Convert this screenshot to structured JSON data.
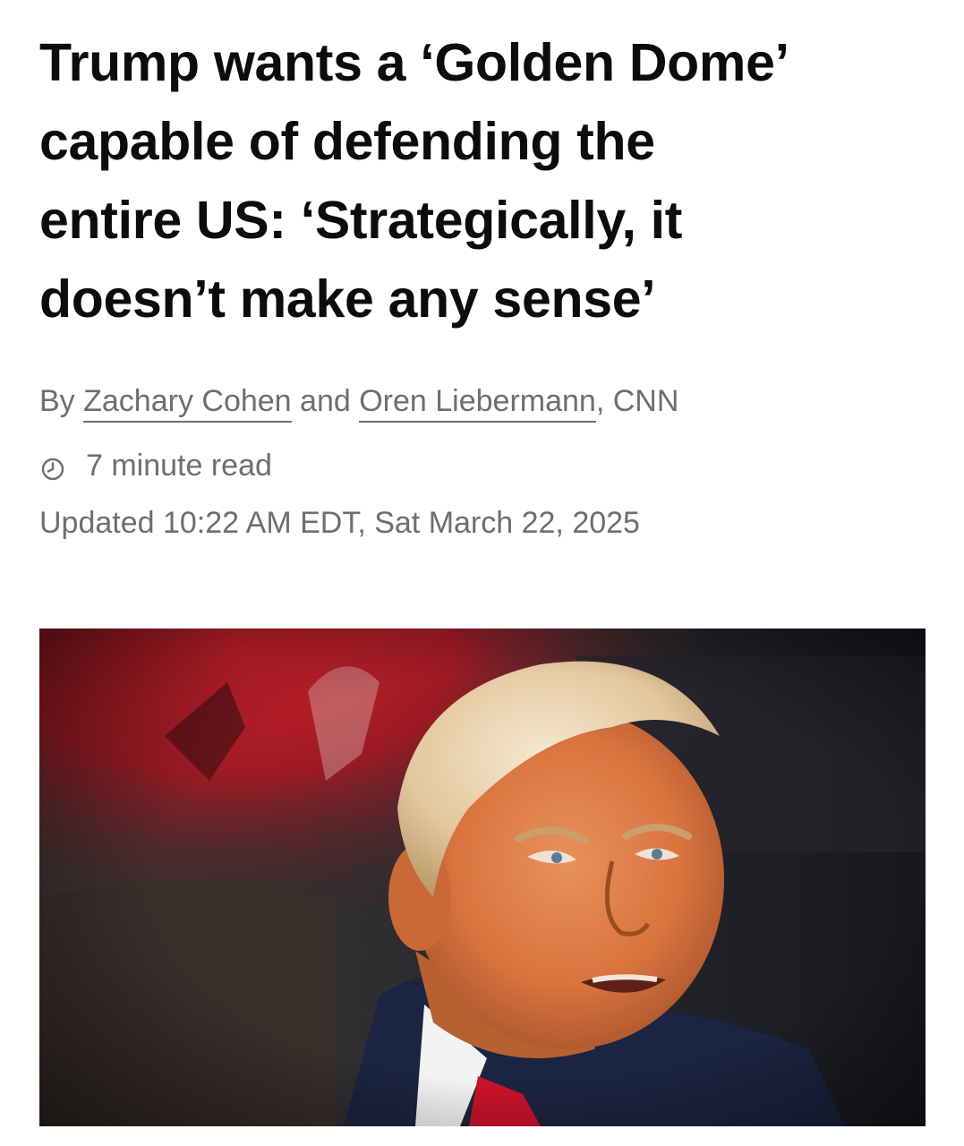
{
  "article": {
    "headline_lines": [
      "Trump wants a ‘Golden Dome’",
      "capable of defending the",
      "entire US: ‘Strategically, it",
      "doesn’t make any sense’"
    ],
    "byline": {
      "prefix": "By ",
      "authors": [
        "Zachary Cohen",
        "Oren Liebermann"
      ],
      "conjunction": " and ",
      "suffix": ", CNN"
    },
    "read_time": "7 minute read",
    "updated": "Updated 10:22 AM EDT, Sat March 22, 2025",
    "icons": {
      "read_time": "clock-icon"
    }
  }
}
